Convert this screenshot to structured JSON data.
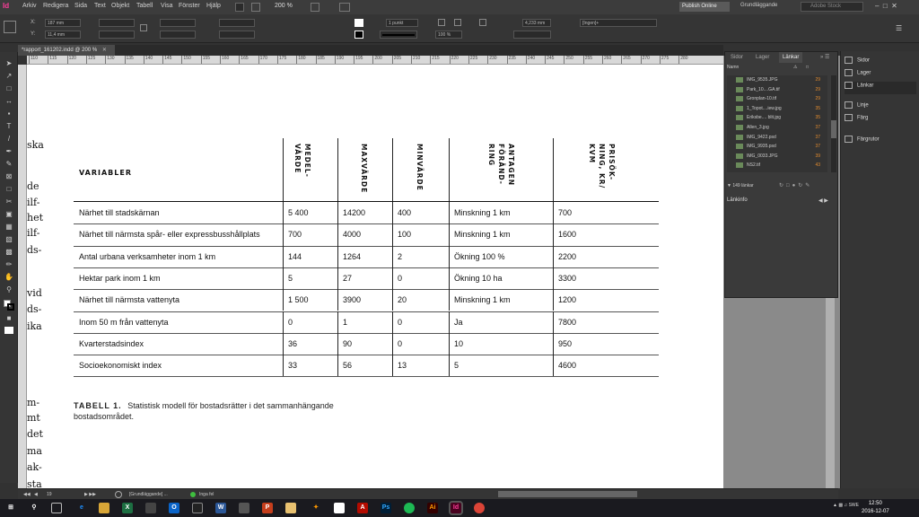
{
  "menubar": {
    "logo": "Id",
    "items": [
      "Arkiv",
      "Redigera",
      "Sida",
      "Text",
      "Objekt",
      "Tabell",
      "Visa",
      "Fönster",
      "Hjälp"
    ],
    "zoom": "200 %",
    "publish": "Publish Online",
    "workspace": "Grundläggande",
    "search_placeholder": "Adobe Stock"
  },
  "control": {
    "x_label": "X:",
    "x_value": "187 mm",
    "y_label": "Y:",
    "y_value": "11,4 mm",
    "stroke_weight": "1 punkt",
    "scale_value": "100 %",
    "size_value": "4,233 mm",
    "style_value": "[Ingen]+"
  },
  "document": {
    "tab_title": "*rapport_161202.indd @ 200 %",
    "ruler_ticks": [
      "110",
      "115",
      "120",
      "125",
      "130",
      "135",
      "140",
      "145",
      "150",
      "155",
      "160",
      "165",
      "170",
      "175",
      "180",
      "185",
      "190",
      "195",
      "200",
      "205",
      "210",
      "215",
      "220",
      "225",
      "230",
      "235",
      "240",
      "245",
      "250",
      "255",
      "260",
      "265",
      "270",
      "275",
      "280"
    ]
  },
  "left_column_fragments": [
    "ska",
    "de",
    "ilf-",
    "het",
    "ilf-",
    "ds-",
    "vid",
    "ds-",
    "ika",
    "m-",
    "mt",
    "det",
    "ma",
    "ak-",
    "sta"
  ],
  "table": {
    "header_variables": "VARIABLER",
    "columns": [
      "MEDEL-\nVÄRDE",
      "MAXVÄRDE",
      "MINVÄRDE",
      "ANTAGEN\nFÖRÄND-\nRING",
      "PRISÖK-\nNING, KR/\nKVM"
    ],
    "rows": [
      [
        "Närhet till stadskärnan",
        "5 400",
        "14200",
        "400",
        "Minskning 1 km",
        "700"
      ],
      [
        "Närhet till närmsta spår- eller expressbusshållplats",
        "700",
        "4000",
        "100",
        "Minskning 1 km",
        "1600"
      ],
      [
        "Antal urbana verksamheter inom 1 km",
        "144",
        "1264",
        "2",
        "Ökning 100 %",
        "2200"
      ],
      [
        "Hektar park inom 1 km",
        "5",
        "27",
        "0",
        "Ökning 10 ha",
        "3300"
      ],
      [
        "Närhet till närmsta vattenyta",
        "1 500",
        "3900",
        "20",
        "Minskning 1 km",
        "1200"
      ],
      [
        "Inom 50 m från vattenyta",
        "0",
        "1",
        "0",
        "Ja",
        "7800"
      ],
      [
        "Kvarterstadsindex",
        "36",
        "90",
        "0",
        "10",
        "950"
      ],
      [
        "Socioekonomiskt index",
        "33",
        "56",
        "13",
        "5",
        "4600"
      ]
    ]
  },
  "caption": {
    "label": "TABELL 1.",
    "text": "Statistisk modell för bostadsrätter i det sammanhängande bostadsområdet."
  },
  "links_panel": {
    "tabs": [
      "Sidor",
      "Lager",
      "Länkar"
    ],
    "column_header": "Namn",
    "links": [
      {
        "name": "IMG_9535.JPG",
        "page": "29"
      },
      {
        "name": "Park_10....GA.tif",
        "page": "29"
      },
      {
        "name": "Gronplan-10.tif",
        "page": "29"
      },
      {
        "name": "1_Topot....iew.jpg",
        "page": "35"
      },
      {
        "name": "Eriksbe.... blit.jpg",
        "page": "35"
      },
      {
        "name": "Allen_3.jpg",
        "page": "37"
      },
      {
        "name": "IMG_9422.psd",
        "page": "37"
      },
      {
        "name": "IMG_9935.psd",
        "page": "37"
      },
      {
        "name": "IMG_0033.JPG",
        "page": "39"
      },
      {
        "name": "NS2.tif",
        "page": "43"
      }
    ],
    "count": "149 länkar",
    "info": "Länkinfo"
  },
  "right_panel": {
    "items": [
      "Sidor",
      "Lager",
      "Länkar",
      "Linje",
      "Färg",
      "Färgrutor"
    ]
  },
  "status": {
    "page": "19",
    "preflight": "[Grundläggande] ...",
    "errors": "Inga fel"
  },
  "taskbar": {
    "lang": "SWE",
    "time": "12:50",
    "date": "2016-12-07"
  }
}
